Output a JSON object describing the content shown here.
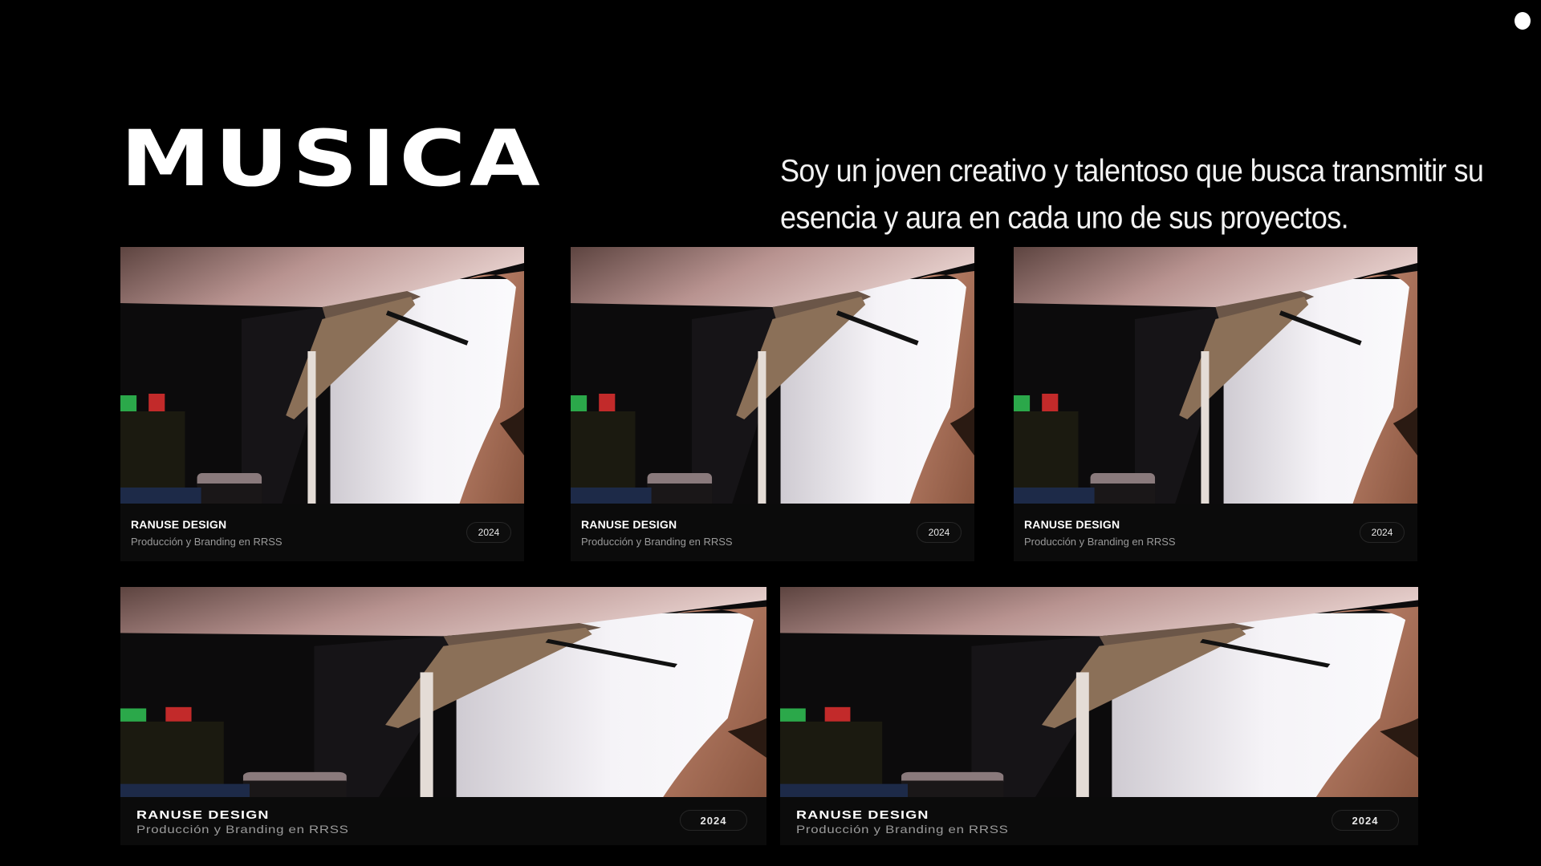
{
  "hero": {
    "title": "MUSICA",
    "tagline": "Soy un joven creativo y talentoso que busca transmitir su esencia y aura en cada uno de sus proyectos."
  },
  "projects": [
    {
      "title": "RANUSE DESIGN",
      "subtitle": "Producción y Branding en RRSS",
      "year": "2024"
    },
    {
      "title": "RANUSE DESIGN",
      "subtitle": "Producción y Branding en RRSS",
      "year": "2024"
    },
    {
      "title": "RANUSE DESIGN",
      "subtitle": "Producción y Branding en RRSS",
      "year": "2024"
    },
    {
      "title": "RANUSE DESIGN",
      "subtitle": "Producción y Branding en RRSS",
      "year": "2024"
    },
    {
      "title": "RANUSE DESIGN",
      "subtitle": "Producción y Branding en RRSS",
      "year": "2024"
    }
  ],
  "colors": {
    "background": "#000000",
    "card": "#0b0b0b",
    "text": "#ffffff",
    "muted": "#9a9a9a"
  }
}
